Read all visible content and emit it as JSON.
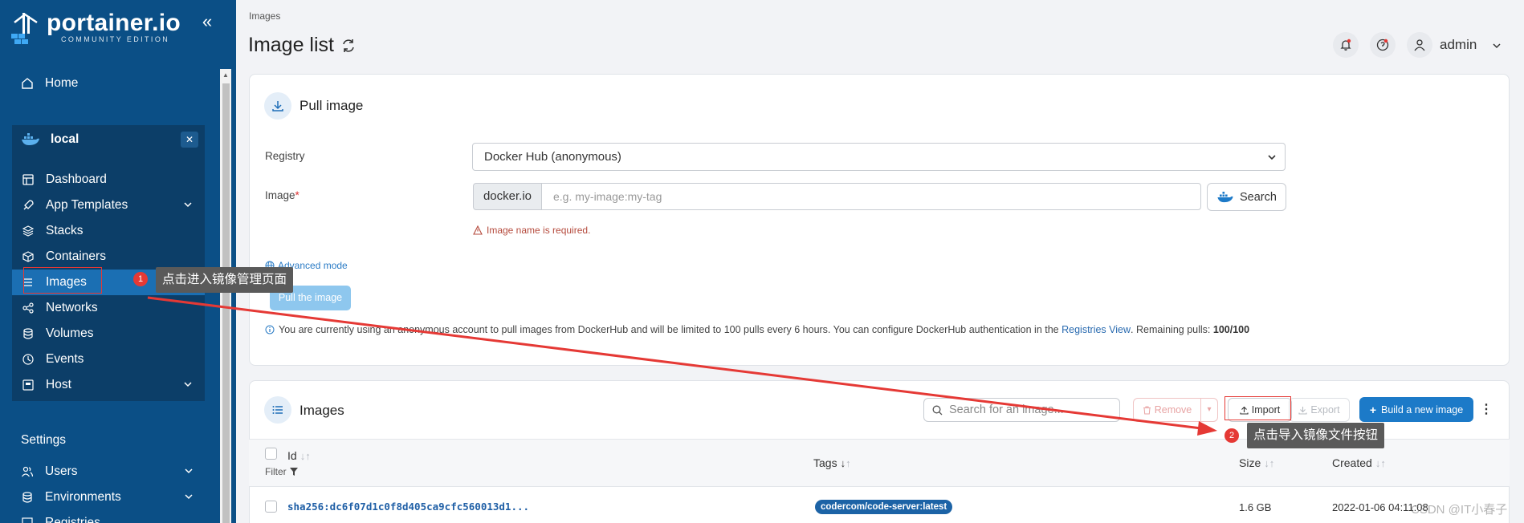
{
  "sidebar": {
    "logo_title": "portainer.io",
    "logo_sub": "COMMUNITY EDITION",
    "home": "Home",
    "env_name": "local",
    "env_items": [
      {
        "label": "Dashboard",
        "icon": "dashboard-icon"
      },
      {
        "label": "App Templates",
        "icon": "rocket-icon"
      },
      {
        "label": "Stacks",
        "icon": "layers-icon"
      },
      {
        "label": "Containers",
        "icon": "box-icon"
      },
      {
        "label": "Images",
        "icon": "list-icon"
      },
      {
        "label": "Networks",
        "icon": "share-icon"
      },
      {
        "label": "Volumes",
        "icon": "database-icon"
      },
      {
        "label": "Events",
        "icon": "clock-icon"
      },
      {
        "label": "Host",
        "icon": "host-icon"
      }
    ],
    "settings_title": "Settings",
    "settings_items": [
      {
        "label": "Users"
      },
      {
        "label": "Environments"
      },
      {
        "label": "Registries"
      }
    ]
  },
  "header": {
    "breadcrumb": "Images",
    "title": "Image list",
    "user": "admin"
  },
  "pull": {
    "title": "Pull image",
    "registry_label": "Registry",
    "registry_value": "Docker Hub (anonymous)",
    "image_label": "Image",
    "image_required": "*",
    "image_prefix": "docker.io",
    "image_placeholder": "e.g. my-image:my-tag",
    "search_label": "Search",
    "error": "Image name is required.",
    "advanced": "Advanced mode",
    "pull_button": "Pull the image",
    "info_text": "You are currently using an anonymous account to pull images from DockerHub and will be limited to 100 pulls every 6 hours. You can configure DockerHub authentication in the",
    "info_link": "Registries View",
    "info_after": ". Remaining pulls:",
    "info_remaining": "100/100"
  },
  "images": {
    "title": "Images",
    "search_placeholder": "Search for an image...",
    "remove": "Remove",
    "import": "Import",
    "export": "Export",
    "build": "Build a new image",
    "columns": {
      "id": "Id",
      "filter": "Filter",
      "tags": "Tags",
      "size": "Size",
      "created": "Created"
    },
    "rows": [
      {
        "id": "sha256:dc6f07d1c0f8d405ca9cfc560013d1...",
        "tag": "codercom/code-server:latest",
        "size": "1.6 GB",
        "created": "2022-01-06 04:11:08"
      }
    ]
  },
  "annotations": {
    "step1_num": "1",
    "step1_text": "点击进入镜像管理页面",
    "step2_num": "2",
    "step2_text": "点击导入镜像文件按钮",
    "color": "#e53935"
  },
  "watermark": "CSDN @IT小春子"
}
